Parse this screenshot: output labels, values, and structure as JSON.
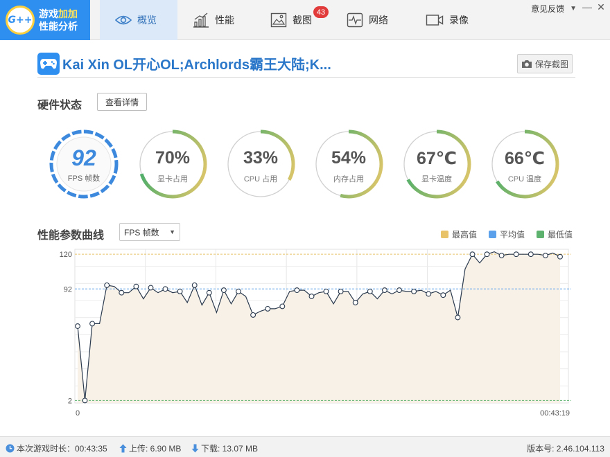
{
  "app": {
    "logo_badge": "G++",
    "logo_line1_a": "游戏",
    "logo_line1_b": "加加",
    "logo_line2": "性能分析"
  },
  "tabs": [
    {
      "label": "概览",
      "icon": "eye-icon",
      "active": true
    },
    {
      "label": "性能",
      "icon": "bar-chart-icon",
      "active": false
    },
    {
      "label": "截图",
      "icon": "image-icon",
      "active": false,
      "badge": "43"
    },
    {
      "label": "网络",
      "icon": "pulse-icon",
      "active": false
    },
    {
      "label": "录像",
      "icon": "video-icon",
      "active": false
    }
  ],
  "window": {
    "feedback": "意见反馈",
    "dropdown_glyph": "▼",
    "minimize_glyph": "—",
    "close_glyph": "✕"
  },
  "game": {
    "title": "Kai Xin OL开心OL;Archlords霸王大陆;K...",
    "save_label": "保存截图"
  },
  "hardware": {
    "title": "硬件状态",
    "detail_label": "查看详情",
    "gauges": [
      {
        "value": "92",
        "label": "FPS 帧数",
        "type": "fps"
      },
      {
        "value": "70%",
        "label": "显卡占用",
        "fill": 0.7
      },
      {
        "value": "33%",
        "label": "CPU 占用",
        "fill": 0.33
      },
      {
        "value": "54%",
        "label": "内存占用",
        "fill": 0.54
      },
      {
        "value": "67℃",
        "label": "显卡温度",
        "fill": 0.67
      },
      {
        "value": "66℃",
        "label": "CPU 温度",
        "fill": 0.66
      }
    ],
    "colors": {
      "gauge_start": "#e7c76a",
      "gauge_end": "#4fae6a",
      "track": "#d0d0d0",
      "fps": "#3c89dd"
    }
  },
  "curve": {
    "title": "性能参数曲线",
    "select_value": "FPS  帧数",
    "legend": [
      {
        "label": "最高值",
        "color": "#e8c36a"
      },
      {
        "label": "平均值",
        "color": "#5aa0ea"
      },
      {
        "label": "最低值",
        "color": "#5db36e"
      }
    ]
  },
  "chart_data": {
    "type": "line",
    "series": [
      {
        "values": [
          62,
          2,
          64,
          64,
          95,
          94,
          89,
          89,
          94,
          84,
          93,
          89,
          92,
          89,
          90,
          81,
          95,
          79,
          89,
          73,
          91,
          80,
          90,
          86,
          71,
          74,
          76,
          76,
          78,
          90,
          91,
          91,
          86,
          89,
          90,
          80,
          90,
          90,
          81,
          88,
          90,
          84,
          91,
          88,
          91,
          90,
          90,
          91,
          88,
          90,
          87,
          91,
          69,
          108,
          120,
          113,
          120,
          122,
          119,
          120,
          120,
          120,
          120,
          120,
          119,
          121,
          118
        ]
      }
    ],
    "markers_every": 2,
    "ylim": [
      0,
      124
    ],
    "yticks": [
      "120",
      "92",
      "2"
    ],
    "max": 120,
    "avg": 92,
    "min": 2,
    "x_start_label": "0",
    "x_end_label": "00:43:19",
    "grid": true
  },
  "status": {
    "duration": "本次游戏时长：00:43:35",
    "upload": "上传: 6.90 MB",
    "download": "下载: 13.07 MB",
    "version": "版本号: 2.46.104.113"
  }
}
